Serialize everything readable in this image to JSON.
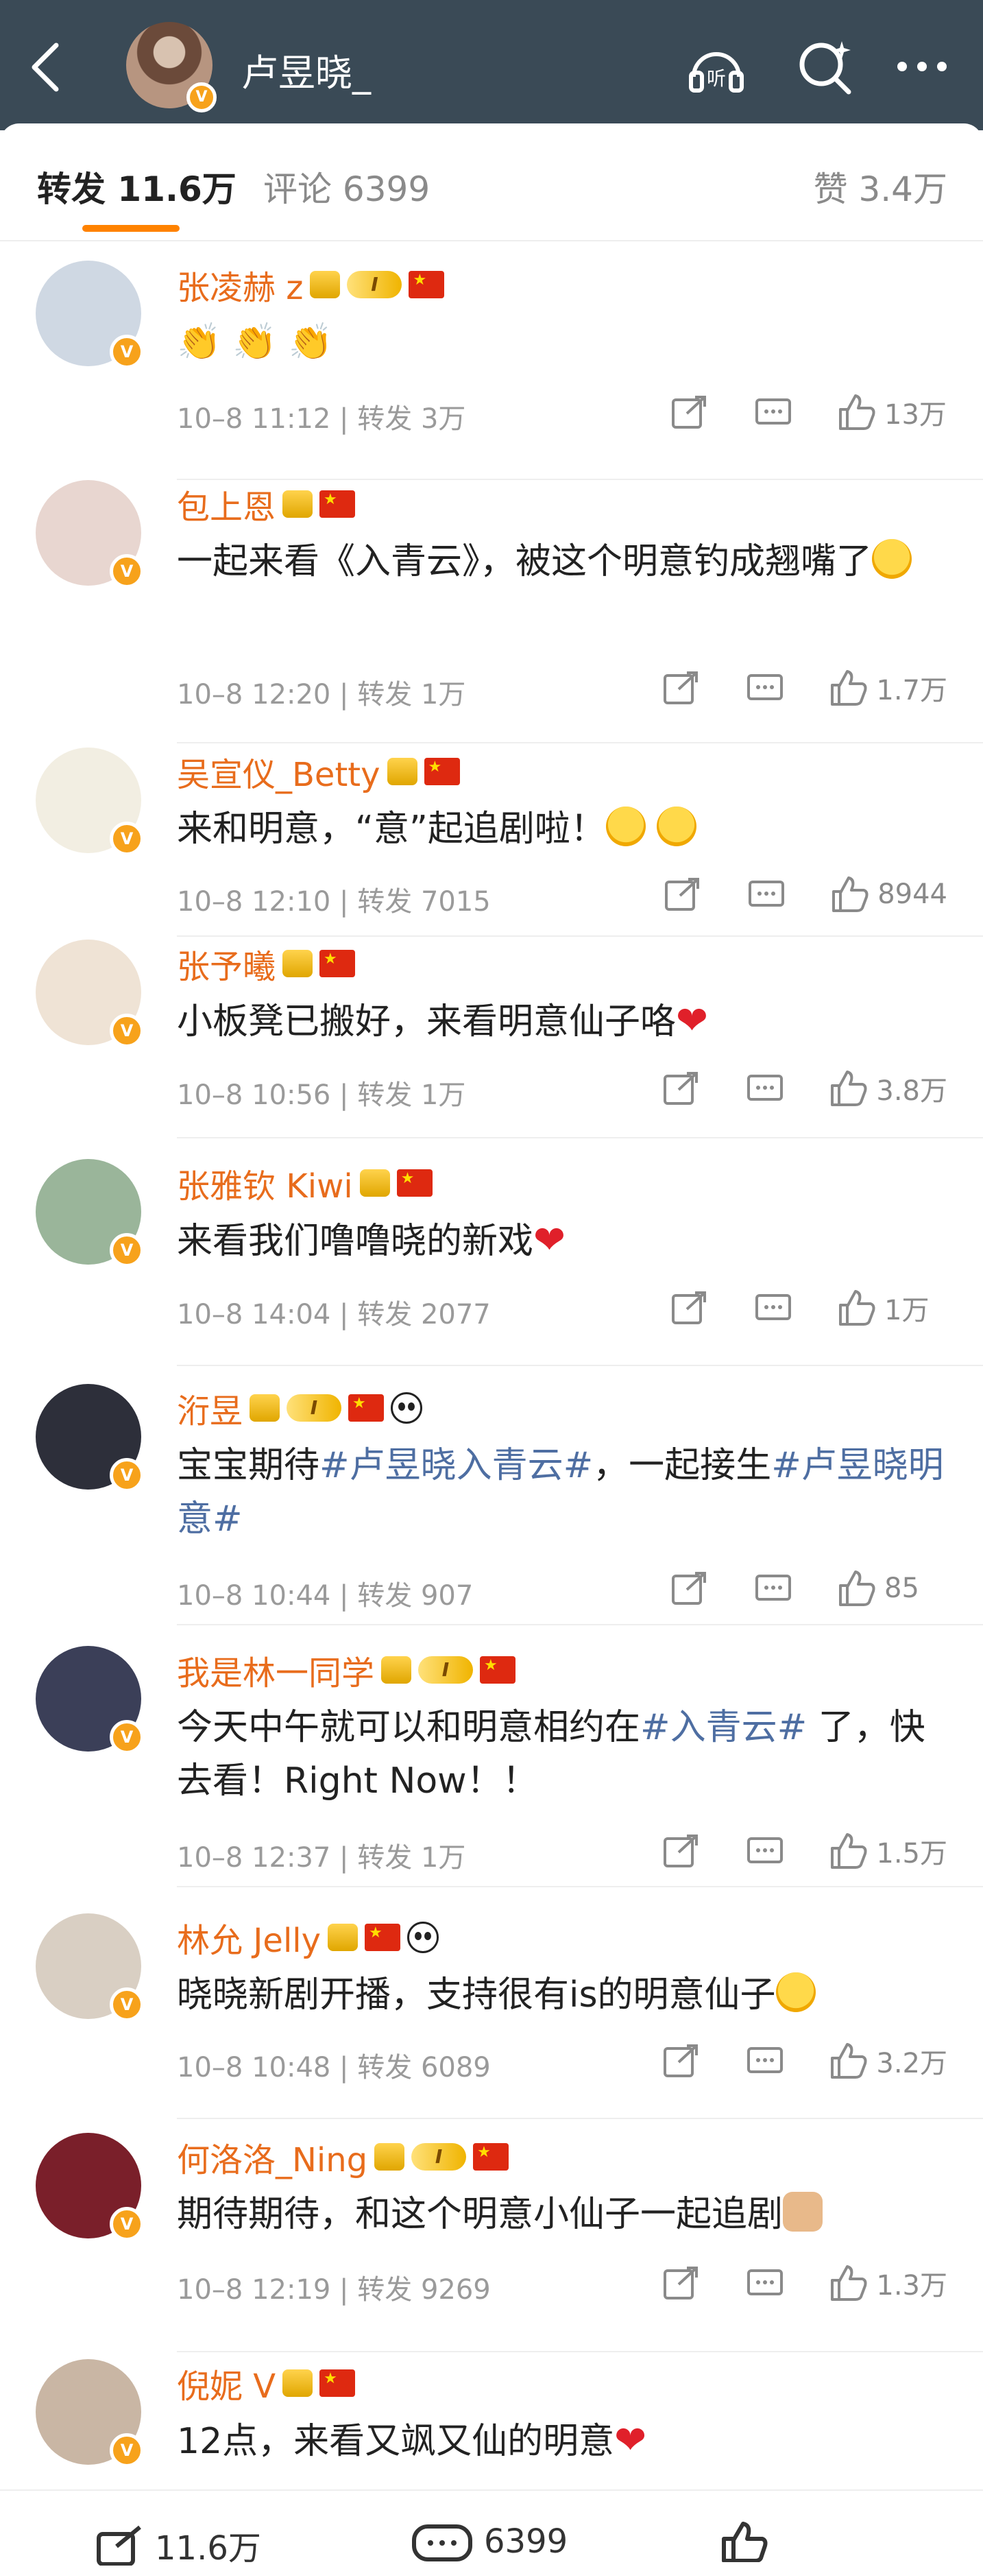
{
  "header": {
    "username": "卢昱晓_"
  },
  "tabs": {
    "repost": "转发 11.6万",
    "comment": "评论 6399",
    "like": "赞 3.4万"
  },
  "items": [
    {
      "name": "张凌赫 z",
      "badges": [
        "crown",
        "level",
        "flag"
      ],
      "level": "I",
      "content": [
        {
          "t": "clap"
        },
        {
          "t": "clap"
        },
        {
          "t": "clap"
        }
      ],
      "time": "10–8 11:12",
      "repost": "转发 3万",
      "likes": "13万",
      "avatar_color": "#cfd8e3"
    },
    {
      "name": "包上恩",
      "badges": [
        "crown",
        "flag"
      ],
      "content": [
        {
          "t": "text",
          "v": "一起来看《入青云》，被这个明意钓成翘嘴了"
        },
        {
          "t": "emo"
        }
      ],
      "time": "10–8 12:20",
      "repost": "转发 1万",
      "likes": "1.7万",
      "avatar_color": "#e8d6d0"
    },
    {
      "name": "吴宣仪_Betty",
      "badges": [
        "crown",
        "flag"
      ],
      "content": [
        {
          "t": "text",
          "v": "来和明意，“意”起追剧啦！"
        },
        {
          "t": "emo"
        },
        {
          "t": "emo"
        }
      ],
      "time": "10–8 12:10",
      "repost": "转发 7015",
      "likes": "8944",
      "avatar_color": "#f2eee2"
    },
    {
      "name": "张予曦",
      "badges": [
        "crown",
        "flag"
      ],
      "content": [
        {
          "t": "text",
          "v": "小板凳已搬好，来看明意仙子咯"
        },
        {
          "t": "heart"
        }
      ],
      "time": "10–8 10:56",
      "repost": "转发 1万",
      "likes": "3.8万",
      "avatar_color": "#efe3d5"
    },
    {
      "name": "张雅钦 Kiwi",
      "badges": [
        "crown",
        "flag"
      ],
      "content": [
        {
          "t": "text",
          "v": "来看我们噜噜晓的新戏"
        },
        {
          "t": "heart"
        }
      ],
      "time": "10–8 14:04",
      "repost": "转发 2077",
      "likes": "1万",
      "avatar_color": "#9ab59a"
    },
    {
      "name": "洐昱",
      "badges": [
        "crown",
        "level",
        "flag",
        "panda"
      ],
      "level": "I",
      "content": [
        {
          "t": "text",
          "v": "宝宝期待"
        },
        {
          "t": "topic",
          "v": "#卢昱晓入青云#"
        },
        {
          "t": "text",
          "v": "，一起接生"
        },
        {
          "t": "topic",
          "v": "#卢昱晓明意#"
        }
      ],
      "time": "10–8 10:44",
      "repost": "转发 907",
      "likes": "85",
      "avatar_color": "#2d2f3a"
    },
    {
      "name": "我是林一同学",
      "badges": [
        "crown",
        "level",
        "flag"
      ],
      "level": "I",
      "content": [
        {
          "t": "text",
          "v": "今天中午就可以和明意相约在"
        },
        {
          "t": "topic",
          "v": "#入青云#"
        },
        {
          "t": "text",
          "v": " 了，快去看！Right Now！！"
        }
      ],
      "time": "10–8 12:37",
      "repost": "转发 1万",
      "likes": "1.5万",
      "avatar_color": "#3b3f58"
    },
    {
      "name": "林允 Jelly",
      "badges": [
        "crown",
        "flag",
        "panda"
      ],
      "content": [
        {
          "t": "text",
          "v": "晓晓新剧开播，支持很有is的明意仙子"
        },
        {
          "t": "emo"
        }
      ],
      "time": "10–8 10:48",
      "repost": "转发 6089",
      "likes": "3.2万",
      "avatar_color": "#d9cfc3"
    },
    {
      "name": "何洛洛_Ning",
      "badges": [
        "crown",
        "level",
        "flag"
      ],
      "level": "I",
      "content": [
        {
          "t": "text",
          "v": "期待期待，和这个明意小仙子一起追剧"
        },
        {
          "t": "fist"
        }
      ],
      "time": "10–8 12:19",
      "repost": "转发 9269",
      "likes": "1.3万",
      "avatar_color": "#7a1f2a"
    },
    {
      "name": "倪妮 V",
      "badges": [
        "crown",
        "flag"
      ],
      "content": [
        {
          "t": "text",
          "v": "12点，来看又飒又仙的明意"
        },
        {
          "t": "heart"
        }
      ],
      "time": "",
      "repost": "",
      "likes": "",
      "avatar_color": "#c9b6a4"
    }
  ],
  "bottom": {
    "repost": "11.6万",
    "comment": "6399"
  }
}
